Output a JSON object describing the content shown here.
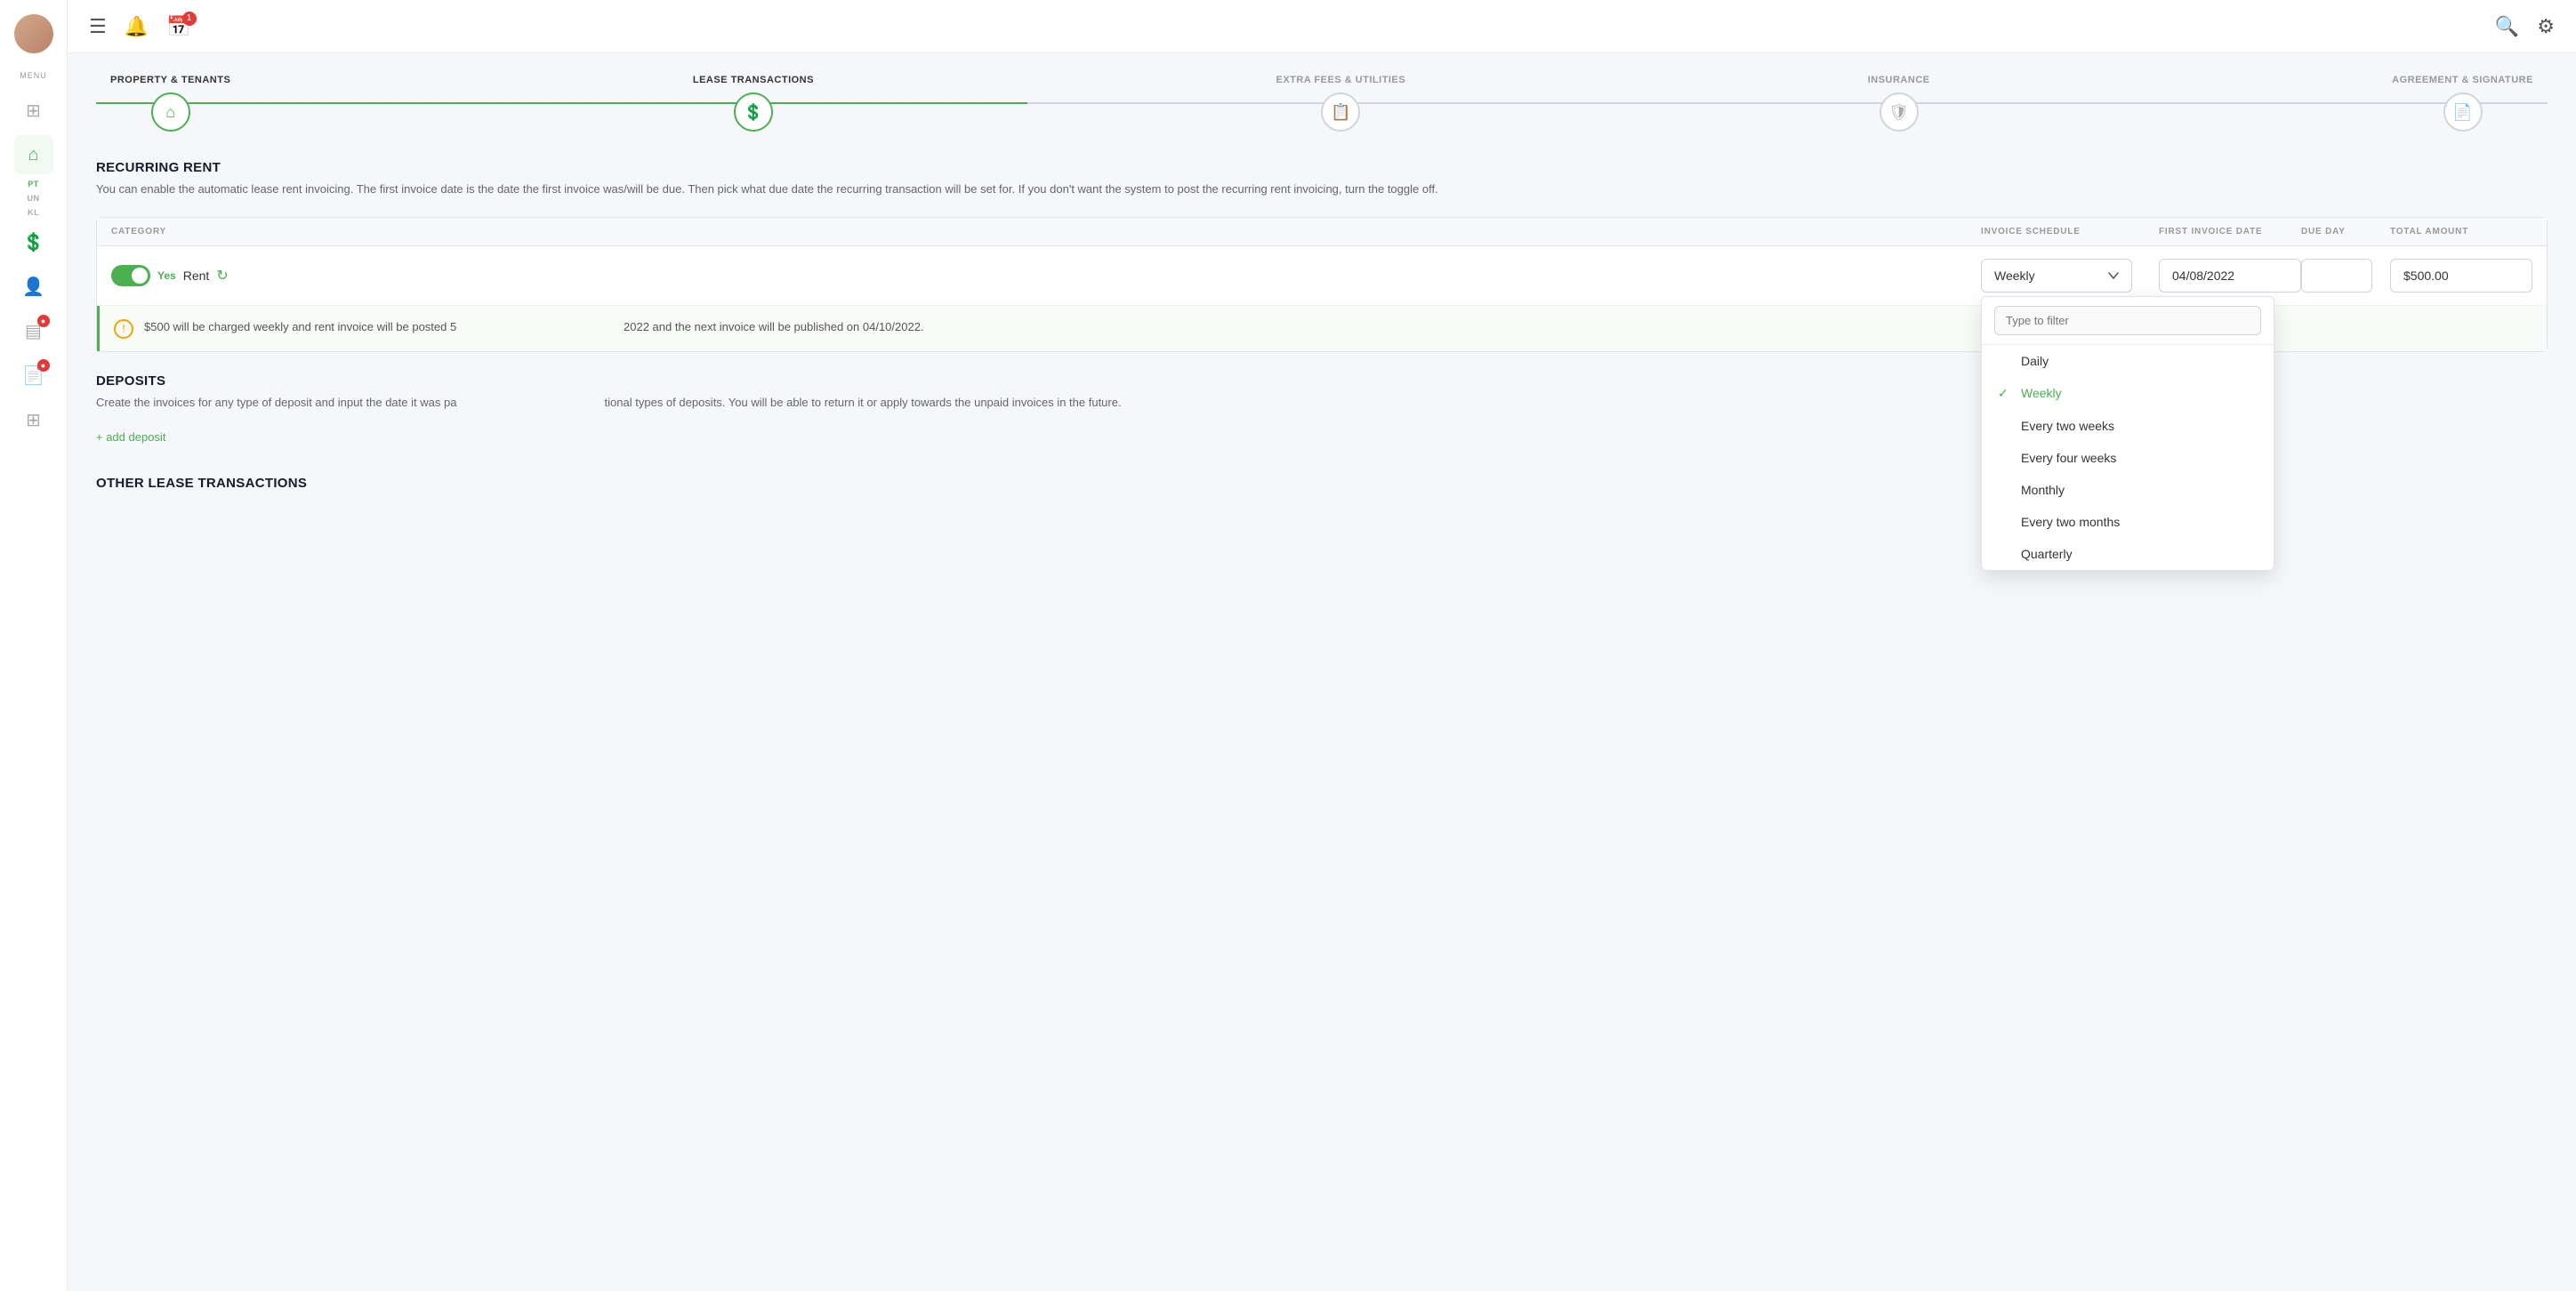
{
  "sidebar": {
    "menu_label": "MENU",
    "icons": [
      {
        "name": "dashboard-icon",
        "symbol": "⊞",
        "active": false,
        "badge": null
      },
      {
        "name": "home-icon",
        "symbol": "⌂",
        "active": true,
        "badge": null
      },
      {
        "name": "currency-icon",
        "symbol": "💲",
        "active": false,
        "badge": null
      },
      {
        "name": "people-icon",
        "symbol": "👤",
        "active": false,
        "badge": null
      },
      {
        "name": "chart-icon",
        "symbol": "▤",
        "active": false,
        "badge": null
      },
      {
        "name": "report-icon",
        "symbol": "⊟",
        "active": false,
        "badge": "●"
      },
      {
        "name": "document-icon",
        "symbol": "📄",
        "active": false,
        "badge": "●"
      },
      {
        "name": "grid-icon",
        "symbol": "⊞",
        "active": false,
        "badge": null
      }
    ],
    "text_labels": [
      {
        "text": "PT",
        "green": true
      },
      {
        "text": "UN",
        "green": false
      },
      {
        "text": "KL",
        "green": false
      }
    ]
  },
  "topbar": {
    "hamburger": "☰",
    "notification_icon": "🔔",
    "calendar_icon": "📅",
    "calendar_badge": "1",
    "search_icon": "🔍",
    "settings_icon": "⚙"
  },
  "steps": [
    {
      "label": "PROPERTY & TENANTS",
      "icon": "⌂",
      "state": "completed"
    },
    {
      "label": "LEASE TRANSACTIONS",
      "icon": "💲",
      "state": "active"
    },
    {
      "label": "EXTRA FEES & UTILITIES",
      "icon": "📋",
      "state": "inactive"
    },
    {
      "label": "INSURANCE",
      "icon": "🛡",
      "state": "inactive"
    },
    {
      "label": "AGREEMENT & SIGNATURE",
      "icon": "📄",
      "state": "inactive"
    }
  ],
  "recurring_rent": {
    "title": "RECURRING RENT",
    "description": "You can enable the automatic lease rent invoicing. The first invoice date is the date the first invoice was/will be due. Then pick what due date the recurring transaction will be set for. If you don't want the system to post the recurring rent invoicing, turn the toggle off.",
    "table": {
      "headers": [
        "CATEGORY",
        "INVOICE SCHEDULE",
        "FIRST INVOICE DATE",
        "DUE DAY",
        "TOTAL AMOUNT"
      ],
      "row": {
        "toggle_label": "Yes",
        "category_label": "Rent",
        "schedule_value": "Weekly",
        "first_invoice_date": "04/08/2022",
        "due_day": "",
        "total_amount": "$500.00"
      }
    },
    "info_text": "$500 will be charged weekly and rent invoice will be posted 5",
    "info_text2": "2022 and the next invoice will be published on 04/10/2022."
  },
  "dropdown": {
    "filter_placeholder": "Type to filter",
    "options": [
      {
        "label": "Daily",
        "selected": false
      },
      {
        "label": "Weekly",
        "selected": true
      },
      {
        "label": "Every two weeks",
        "selected": false
      },
      {
        "label": "Every four weeks",
        "selected": false
      },
      {
        "label": "Monthly",
        "selected": false
      },
      {
        "label": "Every two months",
        "selected": false
      },
      {
        "label": "Quarterly",
        "selected": false
      }
    ]
  },
  "deposits": {
    "title": "DEPOSITS",
    "description": "Create the invoices for any type of deposit and input the date it was pa",
    "description2": "tional types of deposits. You will be able to return it or apply towards the unpaid invoices in the future.",
    "add_label": "+ add deposit"
  },
  "other_section": {
    "title": "OTHER LEASE TRANSACTIONS"
  }
}
